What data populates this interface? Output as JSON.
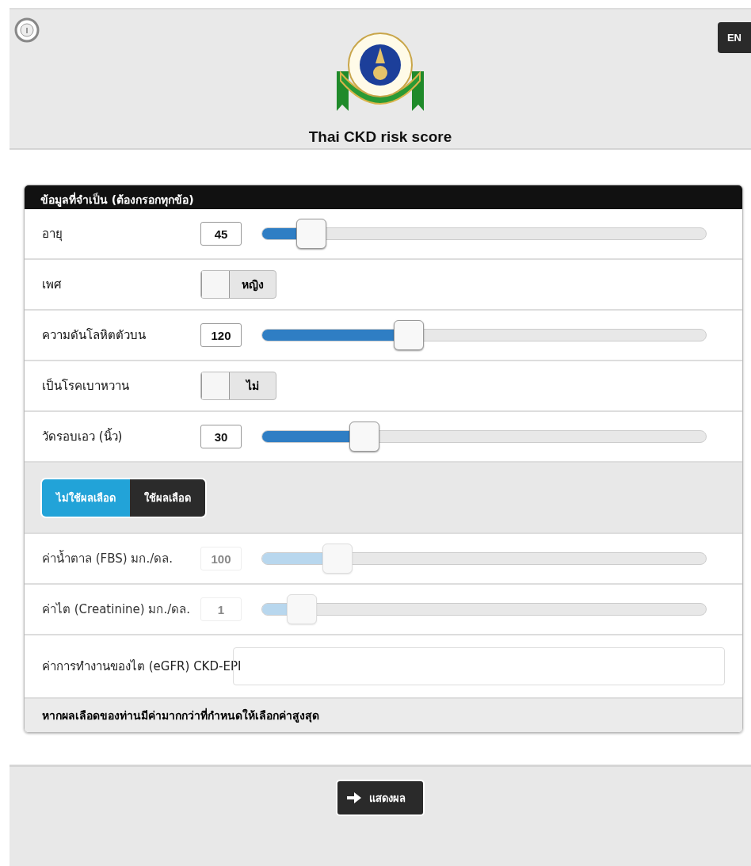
{
  "header": {
    "title": "Thai CKD risk score",
    "language_button": "EN"
  },
  "panel": {
    "title": "ข้อมูลที่จำเป็น (ต้องกรอกทุกข้อ)",
    "rows": [
      {
        "kind": "slider",
        "label": "อายุ",
        "value": "45",
        "level": 0.11,
        "disabled": false
      },
      {
        "kind": "toggle",
        "label": "เพศ",
        "option": "หญิง",
        "on": false
      },
      {
        "kind": "slider",
        "label": "ความดันโลหิตตัวบน",
        "value": "120",
        "level": 0.33,
        "disabled": false
      },
      {
        "kind": "toggle",
        "label": "เป็นโรคเบาหวาน",
        "option": "ไม่",
        "on": false
      },
      {
        "kind": "slider",
        "label": "วัดรอบเอว (นิ้ว)",
        "value": "30",
        "level": 0.23,
        "disabled": false
      }
    ],
    "modes": [
      {
        "label": "ไม่ใช้ผลเลือด",
        "selected": true
      },
      {
        "label": "ใช้ผลเลือด",
        "selected": false
      }
    ],
    "lab_rows": [
      {
        "kind": "slider",
        "label": "ค่าน้ำตาล (FBS) มก./ดล.",
        "value": "100",
        "level": 0.17,
        "disabled": true
      },
      {
        "kind": "slider",
        "label": "ค่าไต (Creatinine) มก./ดล.",
        "value": "1",
        "level": 0.09,
        "disabled": true
      },
      {
        "kind": "text",
        "label": "ค่าการทำงานของไต (eGFR) CKD-EPI"
      }
    ],
    "note": "หากผลเลือดของท่านมีค่ามากกว่าที่กำหนดให้เลือกค่าสูงสุด"
  },
  "footer": {
    "submit_button": "แสดงผล"
  }
}
